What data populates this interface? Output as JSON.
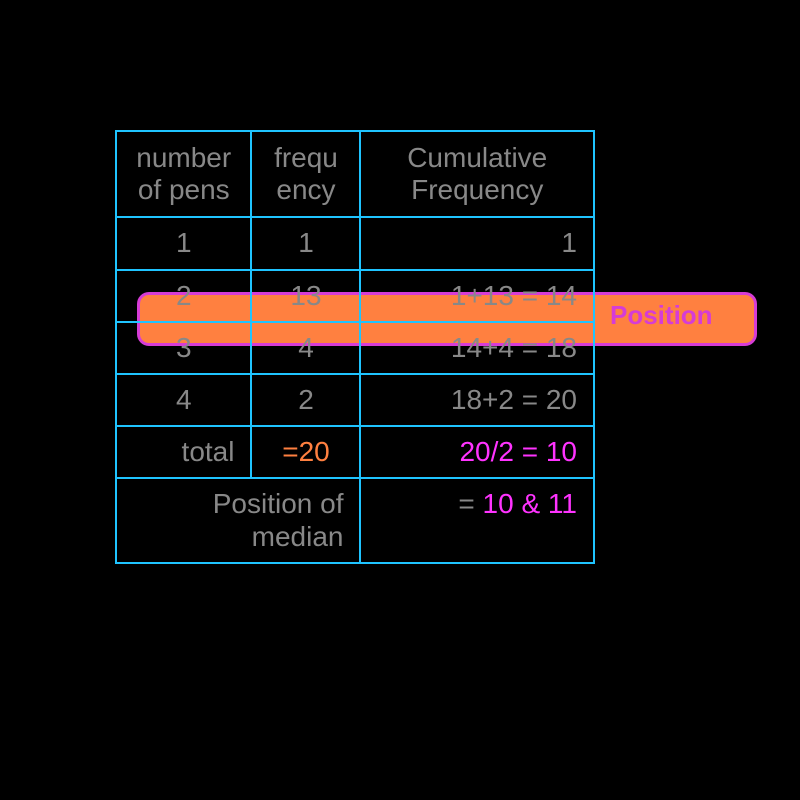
{
  "headers": {
    "c1": "number of pens",
    "c2": "frequ\nency",
    "c3": "Cumulative Frequency"
  },
  "rows": [
    {
      "pens": "1",
      "freq": "1",
      "cum": "1"
    },
    {
      "pens": "2",
      "freq": "13",
      "cum": "1+13 = 14"
    },
    {
      "pens": "3",
      "freq": "4",
      "cum": "14+4 = 18"
    },
    {
      "pens": "4",
      "freq": "2",
      "cum": "18+2 = 20"
    }
  ],
  "total": {
    "label": "total",
    "value": "=20",
    "calc": "20/2 = 10"
  },
  "median": {
    "label": "Position of median",
    "eq": "= ",
    "vals": "10 & 11"
  },
  "position_label": "Position",
  "chart_data": {
    "type": "table",
    "columns": [
      "number of pens",
      "frequency",
      "Cumulative Frequency"
    ],
    "rows": [
      [
        1,
        1,
        1
      ],
      [
        2,
        13,
        14
      ],
      [
        3,
        4,
        18
      ],
      [
        4,
        2,
        20
      ]
    ],
    "total_frequency": 20,
    "median_position_calc": "20/2 = 10",
    "median_positions": [
      10,
      11
    ],
    "highlighted_row_index": 1
  }
}
